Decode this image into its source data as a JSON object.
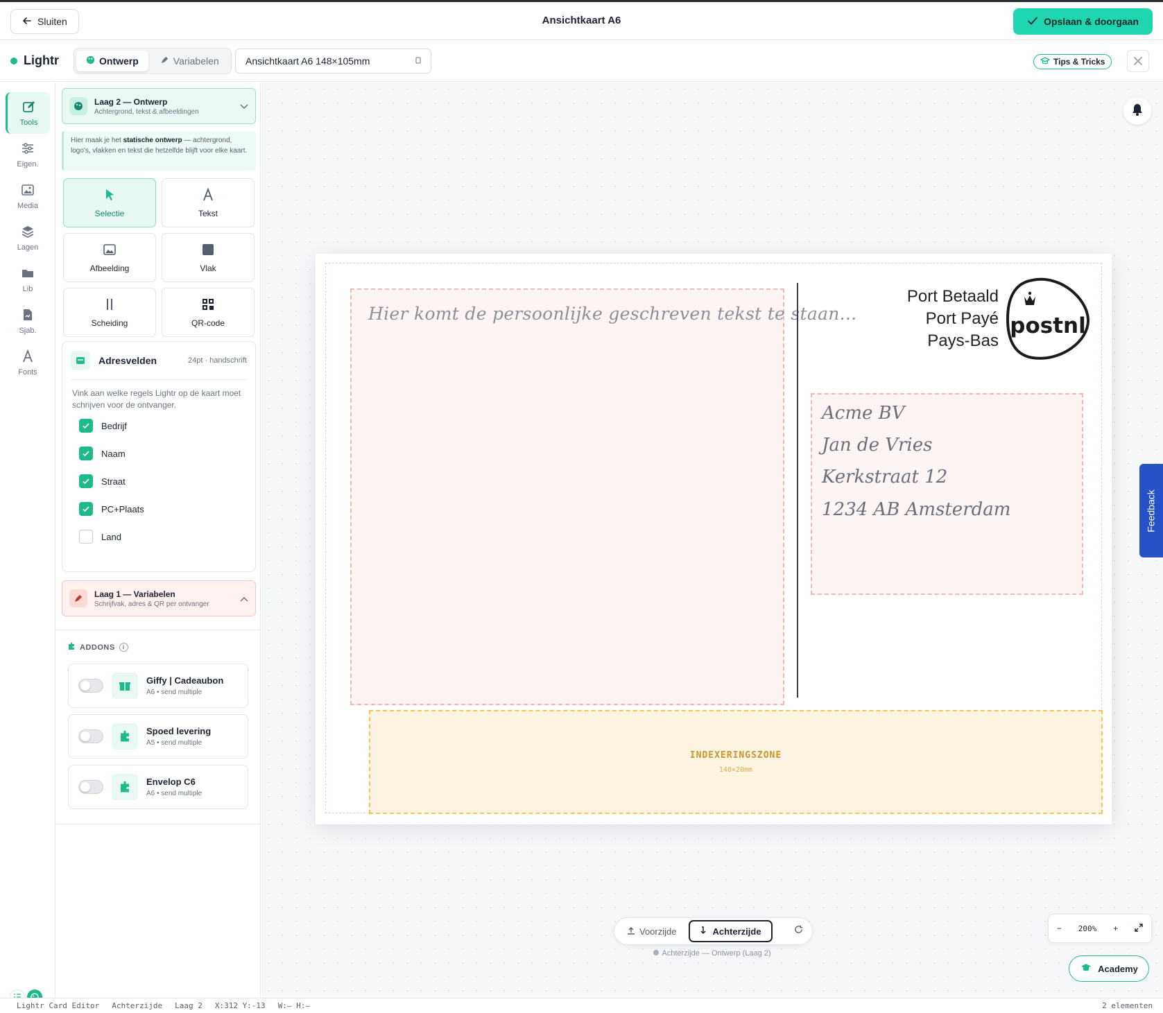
{
  "header": {
    "close_label": "Sluiten",
    "title": "Ansichtkaart A6",
    "save_label": "Opslaan & doorgaan"
  },
  "toolbar": {
    "brand": "Lightr",
    "tabs": [
      {
        "label": "Ontwerp",
        "active": true
      },
      {
        "label": "Variabelen",
        "active": false
      }
    ],
    "format": "Ansichtkaart A6 148×105mm",
    "tips_label": "Tips & Tricks"
  },
  "rail": [
    "Tools",
    "Eigen.",
    "Media",
    "Lagen",
    "Lib",
    "Sjab.",
    "Fonts"
  ],
  "layer2": {
    "title": "Laag 2 — Ontwerp",
    "subtitle": "Achtergrond, tekst & afbeeldingen"
  },
  "hint": {
    "pre": "Hier maak je het ",
    "bold": "statische ontwerp",
    "post": " — achtergrond, logo's, vlakken en tekst die hetzelfde blijft voor elke kaart."
  },
  "tools": [
    "Selectie",
    "Tekst",
    "Afbeelding",
    "Vlak",
    "Scheiding",
    "QR-code"
  ],
  "address_fields": {
    "title": "Adresvelden",
    "meta": "24pt · handschrift",
    "description": "Vink aan welke regels Lightr op de kaart moet schrijven voor de ontvanger.",
    "items": [
      {
        "label": "Bedrijf",
        "checked": true
      },
      {
        "label": "Naam",
        "checked": true
      },
      {
        "label": "Straat",
        "checked": true
      },
      {
        "label": "PC+Plaats",
        "checked": true
      },
      {
        "label": "Land",
        "checked": false
      }
    ]
  },
  "layer1": {
    "title": "Laag 1 — Variabelen",
    "subtitle": "Schrijfvak, adres & QR per ontvanger"
  },
  "addons": {
    "label": "ADDONS",
    "info": "i",
    "items": [
      {
        "name": "Giffy | Cadeaubon",
        "size": "A6",
        "mode": "send multiple",
        "enabled": false,
        "icon": "gift-icon"
      },
      {
        "name": "Spoed levering",
        "size": "A5",
        "mode": "send multiple",
        "enabled": false,
        "icon": "puzzle-icon"
      },
      {
        "name": "Envelop C6",
        "size": "A6",
        "mode": "send multiple",
        "enabled": false,
        "icon": "puzzle-icon"
      }
    ]
  },
  "card": {
    "message_placeholder": "Hier komt de persoonlijke geschreven tekst te staan...",
    "postage": [
      "Port Betaald",
      "Port Payé",
      "Pays-Bas"
    ],
    "postnl_logo": "postnl",
    "address": [
      "Acme BV",
      "Jan de Vries",
      "Kerkstraat 12",
      "1234 AB Amsterdam"
    ],
    "index_zone": "INDEXERINGSZONE",
    "index_dims": "140×20mm"
  },
  "feedback_label": "Feedback",
  "side_switch": {
    "front": "Voorzijde",
    "back": "Achterzijde",
    "active": "back",
    "caption": "Achterzijde — Ontwerp (Laag 2)"
  },
  "zoom": {
    "minus": "−",
    "value": "200%",
    "plus": "+"
  },
  "academy_label": "Academy",
  "status": {
    "app": "Lightr Card Editor",
    "side": "Achterzijde",
    "layer": "Laag 2",
    "coords": "X:312 Y:-13",
    "size": "W:— H:—",
    "count": "2 elementen"
  },
  "colors": {
    "accent": "#1fd6b0",
    "brand_green": "#1fb98e",
    "feedback_blue": "#2652c8",
    "guide_pink": "#f0b9b3",
    "index_yellow": "#f0c55a"
  }
}
